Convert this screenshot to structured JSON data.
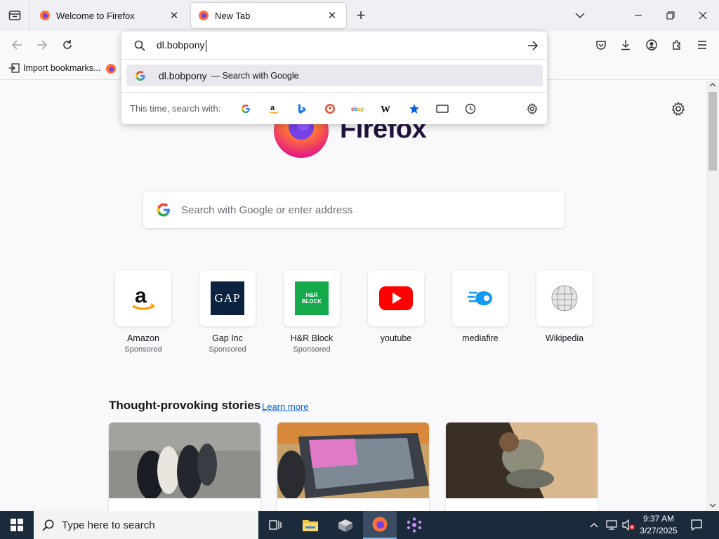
{
  "tabs": [
    {
      "title": "Welcome to Firefox",
      "active": false
    },
    {
      "title": "New Tab",
      "active": true
    }
  ],
  "bookmarks": {
    "import_label": "Import bookmarks..."
  },
  "urlbar": {
    "value": "dl.bobpony",
    "suggestion_text": "dl.bobpony",
    "suggestion_hint": "— Search with Google",
    "one_off_label": "This time, search with:",
    "engines": [
      "google-icon",
      "amazon-icon",
      "bing-icon",
      "duckduckgo-icon",
      "ebay-icon",
      "wikipedia-icon",
      "bookmarks-icon",
      "tabs-icon",
      "history-icon",
      "settings-icon"
    ]
  },
  "newtab": {
    "brand": "Firefox",
    "search_placeholder": "Search with Google or enter address",
    "shortcuts": [
      {
        "name": "Amazon",
        "sponsored": "Sponsored",
        "icon": "amazon-icon"
      },
      {
        "name": "Gap Inc",
        "sponsored": "Sponsored",
        "icon": "gap-icon",
        "logo_text": "GAP"
      },
      {
        "name": "H&R Block",
        "sponsored": "Sponsored",
        "icon": "hrblock-icon",
        "logo_text": "H&R BLOCK"
      },
      {
        "name": "youtube",
        "sponsored": "",
        "icon": "youtube-icon"
      },
      {
        "name": "mediafire",
        "sponsored": "",
        "icon": "mediafire-icon"
      },
      {
        "name": "Wikipedia",
        "sponsored": "",
        "icon": "wikipedia-icon"
      }
    ],
    "stories_title": "Thought-provoking stories",
    "learn_more": "Learn more"
  },
  "taskbar": {
    "search_placeholder": "Type here to search",
    "time": "9:37 AM",
    "date": "3/27/2025"
  },
  "colors": {
    "accent": "#0060df",
    "taskbar": "#1c2b3c"
  }
}
